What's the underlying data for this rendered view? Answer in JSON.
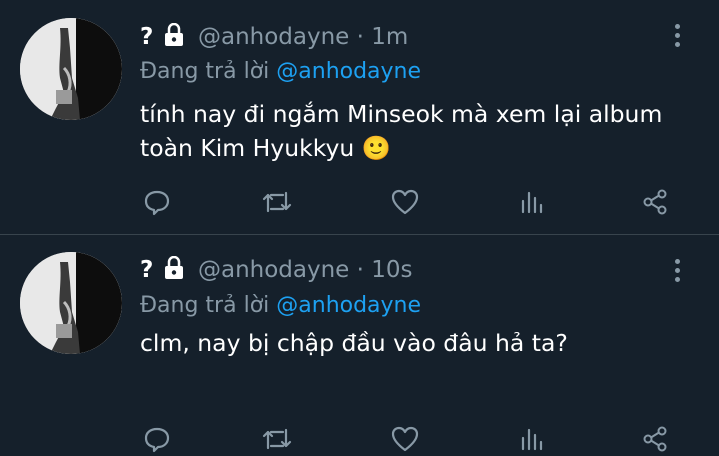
{
  "tweets": [
    {
      "name": "?",
      "handle": "@anhodayne",
      "dot": "·",
      "time": "1m",
      "replying_label": "Đang trả lời",
      "replying_to": "@anhodayne",
      "text": "tính nay đi ngắm Minseok mà xem lại album toàn Kim Hyukkyu 🙂"
    },
    {
      "name": "?",
      "handle": "@anhodayne",
      "dot": "·",
      "time": "10s",
      "replying_label": "Đang trả lời",
      "replying_to": "@anhodayne",
      "text": "clm, nay bị chập đầu vào đâu hả ta?"
    }
  ],
  "icons": {
    "lock": "lock-icon",
    "more": "more-vertical-icon",
    "reply": "reply-icon",
    "retweet": "retweet-icon",
    "like": "like-icon",
    "analytics": "analytics-icon",
    "share": "share-icon"
  },
  "colors": {
    "background": "#15202b",
    "muted": "#8899a6",
    "link": "#1da1f2",
    "divider": "#38444d"
  }
}
